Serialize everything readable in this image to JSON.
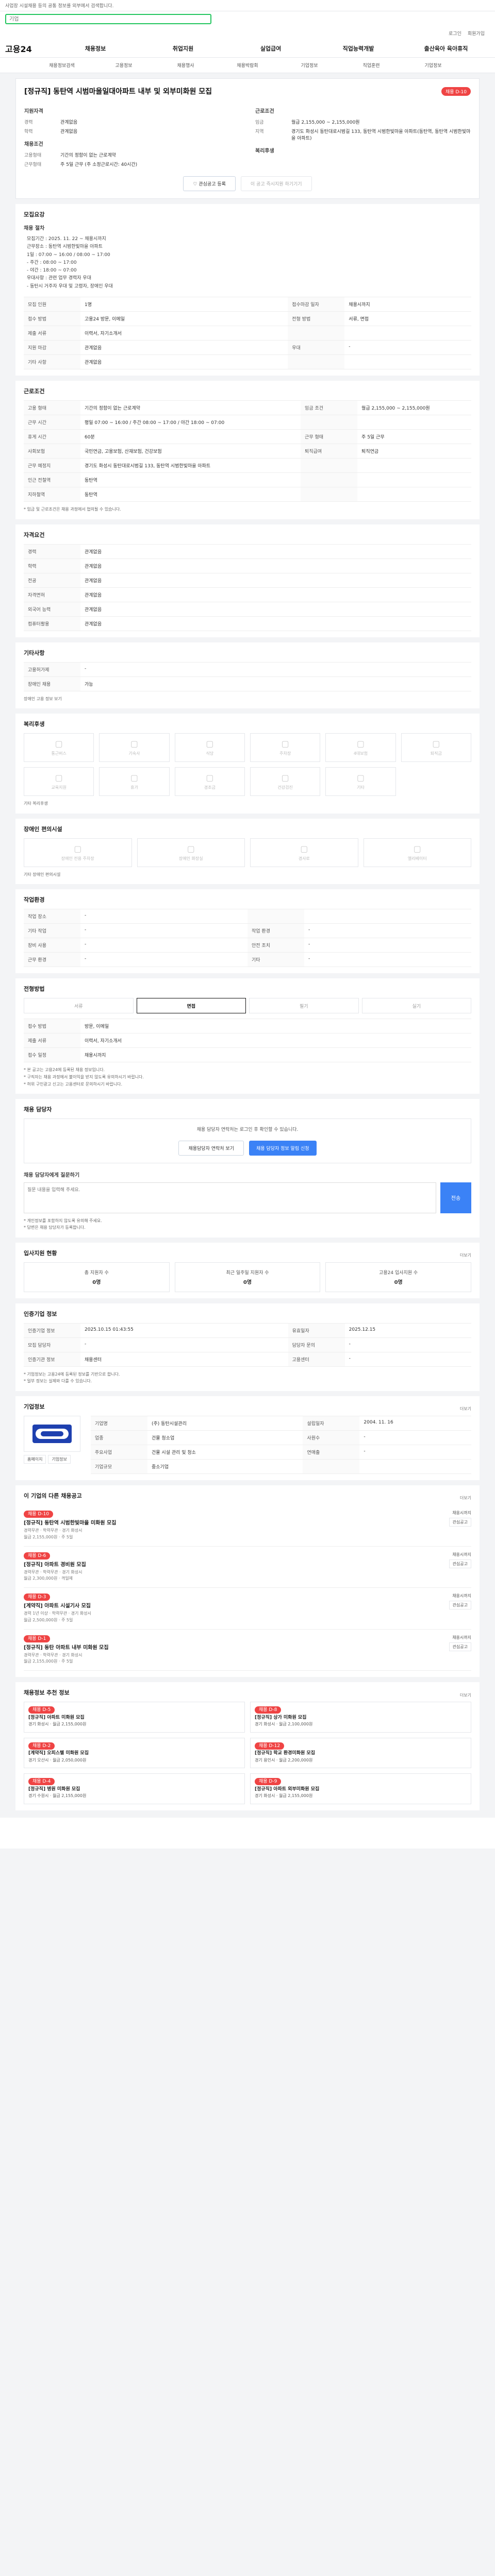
{
  "top": {
    "notice": "사업장 시설채용 등의 공통 정보를 외부에서 검색합니다."
  },
  "search": {
    "placeholder": "기업"
  },
  "login": {
    "login": "로그인",
    "join": "회원가입"
  },
  "logo": "고용24",
  "gnb": [
    "채용정보",
    "취업지원",
    "실업급여",
    "직업능력개발",
    "출산육아 육아휴직"
  ],
  "subnav": [
    "채용정보검색",
    "고용정보",
    "채용행사",
    "채용박람회",
    "기업정보",
    "직업훈련",
    "기업정보"
  ],
  "job": {
    "title": "[정규직] 동탄역 시범마을일대아파트 내부 및 외부미화원 모집",
    "badge": "채용 D-10",
    "summary_h": "지원자격",
    "fields_left": [
      {
        "k": "경력",
        "v": "관계없음"
      },
      {
        "k": "학력",
        "v": "관계없음"
      }
    ],
    "work_h": "근로조건",
    "fields_right": [
      {
        "k": "임금",
        "v": "월급 2,155,000 ~ 2,155,000원"
      },
      {
        "k": "지역",
        "v": "경기도 화성시 동탄대로시범길 133, 동탄역 시범한빛마을 아파트(동탄역, 동탄역 시범한빛마을 아파트)"
      }
    ],
    "extra_h": "채용조건",
    "extra": [
      {
        "k": "고용형태",
        "v": "기간의 정함이 없는 근로계약"
      },
      {
        "k": "근무형태",
        "v": "주 5일 근무 (주 소정근로시간: 40시간)"
      }
    ],
    "perks_h": "복리후생",
    "btn_save": "관심공고 등록",
    "btn_apply": "이 공고 즉시지원 하기기기"
  },
  "process": {
    "h": "모집요강",
    "sub": "채용 절차",
    "items": [
      "모집기간 : 2025. 11. 22 ~ 채용시까지",
      "근무장소 : 동탄역 시범한빛마을 아파트",
      "1일 : 07:00 ~ 16:00 / 08:00 ~ 17:00",
      "- 주간 : 08:00 ~ 17:00",
      "- 야간 : 18:00 ~ 07:00",
      "우대사항 : 관련 업무 경력자 우대",
      "- 동탄시 거주자 우대 및 고령자, 장애인 우대"
    ]
  },
  "reception": {
    "rows": [
      {
        "k": "모집 인원",
        "v": "1명",
        "k2": "접수마감 일자",
        "v2": "채용시까지"
      },
      {
        "k": "접수 방법",
        "v": "고용24 방문, 이메일",
        "k2": "전형 방법",
        "v2": "서류, 면접"
      },
      {
        "k": "제출 서류",
        "v": "이력서, 자기소개서",
        "k2": "",
        "v2": ""
      },
      {
        "k": "지원 마감",
        "v": "관계없음",
        "k2": "우대",
        "v2": "-"
      },
      {
        "k": "기타 사항",
        "v": "관계없음",
        "k2": "",
        "v2": ""
      }
    ]
  },
  "conditions": {
    "h": "근로조건",
    "rows": [
      {
        "k": "고용 형태",
        "v": "기간의 정함이 없는 근로계약",
        "k2": "임금 조건",
        "v2": "월급 2,155,000 ~ 2,155,000원"
      },
      {
        "k": "근무 시간",
        "v": "평일 07:00 ~ 16:00 / 주간 08:00 ~ 17:00 / 야간 18:00 ~ 07:00",
        "k2": "",
        "v2": ""
      },
      {
        "k": "휴게 시간",
        "v": "60분",
        "k2": "근무 형태",
        "v2": "주 5일 근무"
      },
      {
        "k": "사회보험",
        "v": "국민연금, 고용보험, 산재보험, 건강보험",
        "k2": "퇴직급여",
        "v2": "퇴직연금"
      },
      {
        "k": "근무 예정지",
        "v": "경기도 화성시 동탄대로시범길 133, 동탄역 시범한빛마을 아파트",
        "k2": "",
        "v2": ""
      },
      {
        "k": "인근 전철역",
        "v": "동탄역",
        "k2": "",
        "v2": ""
      },
      {
        "k": "지하철역",
        "v": "동탄역",
        "k2": "",
        "v2": ""
      }
    ],
    "note": "* 임금 및 근로조건은 채용 과정에서 협의될 수 있습니다."
  },
  "qualification": {
    "h": "자격요건",
    "rows": [
      {
        "k": "경력",
        "v": "관계없음"
      },
      {
        "k": "학력",
        "v": "관계없음"
      },
      {
        "k": "전공",
        "v": "관계없음"
      },
      {
        "k": "자격면허",
        "v": "관계없음"
      },
      {
        "k": "외국어 능력",
        "v": "관계없음"
      },
      {
        "k": "컴퓨터활용",
        "v": "관계없음"
      }
    ]
  },
  "others": {
    "h": "기타사항",
    "rows": [
      {
        "k": "고용허가제",
        "v": "-"
      },
      {
        "k": "장애인 채용",
        "v": "가능"
      }
    ],
    "link": "장애인 고용 정보 보기"
  },
  "welfare": {
    "h": "복리후생",
    "items": [
      "통근버스",
      "기숙사",
      "식당",
      "주차장",
      "4대보험",
      "퇴직금",
      "교육지원",
      "휴가",
      "경조금",
      "건강검진",
      "기타"
    ],
    "more": "기타 복리후생"
  },
  "disabled": {
    "h": "장애인 편의시설",
    "items": [
      "장애인 전용 주차장",
      "장애인 화장실",
      "경사로",
      "엘리베이터"
    ],
    "more": "기타 장애인 편의시설"
  },
  "environment": {
    "h": "작업환경",
    "rows": [
      {
        "k": "작업 장소",
        "v": "-",
        "k2": "",
        "v2": ""
      },
      {
        "k": "기타 작업",
        "v": "-",
        "k2": "작업 환경",
        "v2": "-"
      },
      {
        "k": "장비 사용",
        "v": "-",
        "k2": "안전 조치",
        "v2": "-"
      },
      {
        "k": "근무 환경",
        "v": "-",
        "k2": "기타",
        "v2": "-"
      }
    ]
  },
  "screening": {
    "h": "전형방법",
    "tabs": [
      "서류",
      "면접",
      "필기",
      "실기"
    ],
    "rows": [
      {
        "k": "접수 방법",
        "v": "방문, 이메일"
      },
      {
        "k": "제출 서류",
        "v": "이력서, 자기소개서"
      },
      {
        "k": "접수 일정",
        "v": "채용시까지"
      }
    ],
    "notes": [
      "* 본 공고는 고용24에 등록된 채용 정보입니다.",
      "* 구직자는 채용 과정에서 불이익을 받지 않도록 유의하시기 바랍니다.",
      "* 허위 구인광고 신고는 고용센터로 문의하시기 바랍니다."
    ]
  },
  "contact": {
    "h": "채용 담당자",
    "text": "채용 담당자 연락처는 로그인 후 확인할 수 있습니다.",
    "btn1": "채용담당자 연락처 보기",
    "btn2": "채용 담당자 정보 알림 신청"
  },
  "qna": {
    "h": "채용 담당자에게 질문하기",
    "placeholder": "질문 내용을 입력해 주세요.",
    "send": "전송",
    "notes": [
      "* 개인정보를 포함하지 않도록 유의해 주세요.",
      "* 답변은 채용 담당자가 등록합니다."
    ]
  },
  "stats": {
    "h": "입사지원 현황",
    "more": "더보기",
    "items": [
      {
        "label": "총 지원자 수",
        "value": "0명"
      },
      {
        "label": "최근 일주일 지원자 수",
        "value": "0명"
      },
      {
        "label": "고용24 입사지원 수",
        "value": "0명"
      }
    ]
  },
  "office": {
    "h": "인증기업 정보",
    "rows": [
      {
        "k": "인증기업 정보",
        "v": "2025.10.15 01:43:55",
        "k2": "유효일자",
        "v2": "2025.12.15"
      },
      {
        "k": "모집 담당자",
        "v": "-",
        "k2": "담당자 문의",
        "v2": "-"
      },
      {
        "k": "인증기관 정보",
        "v": "채용센터",
        "k2": "고용센터",
        "v2": "-"
      }
    ],
    "notes": [
      "* 기업정보는 고용24에 등록된 정보를 기반으로 합니다.",
      "* 일부 정보는 실제와 다를 수 있습니다."
    ]
  },
  "company": {
    "h": "기업정보",
    "more": "더보기",
    "rows": [
      {
        "k": "기업명",
        "v": "(주) 동탄시설관리",
        "k2": "설립일자",
        "v2": "2004. 11. 16"
      },
      {
        "k": "업종",
        "v": "건물 청소업",
        "k2": "사원수",
        "v2": "-"
      },
      {
        "k": "주요사업",
        "v": "건물 시설 관리 및 청소",
        "k2": "연매출",
        "v2": "-"
      },
      {
        "k": "기업규모",
        "v": "중소기업",
        "k2": "",
        "v2": ""
      }
    ],
    "chips": [
      "홈페이지",
      "기업정보"
    ]
  },
  "others_jobs": {
    "h": "이 기업의 다른 채용공고",
    "more": "더보기",
    "items": [
      {
        "tag": "채용 D-10",
        "title": "[정규직] 동탄역 시범한빛마을 미화원 모집",
        "meta1": "경력무관 · 학력무관 · 경기 화성시",
        "meta2": "월급 2,155,000원 · 주 5일",
        "side1": "채용시까지",
        "side2": "관심공고"
      },
      {
        "tag": "채용 D-6",
        "title": "[정규직] 아파트 경비원 모집",
        "meta1": "경력무관 · 학력무관 · 경기 화성시",
        "meta2": "월급 2,300,000원 · 격일제",
        "side1": "채용시까지",
        "side2": "관심공고"
      },
      {
        "tag": "채용 D-3",
        "title": "[계약직] 아파트 시설기사 모집",
        "meta1": "경력 1년 이상 · 학력무관 · 경기 화성시",
        "meta2": "월급 2,500,000원 · 주 5일",
        "side1": "채용시까지",
        "side2": "관심공고"
      },
      {
        "tag": "채용 D-1",
        "title": "[정규직] 동탄 아파트 내부 미화원 모집",
        "meta1": "경력무관 · 학력무관 · 경기 화성시",
        "meta2": "월급 2,155,000원 · 주 5일",
        "side1": "채용시까지",
        "side2": "관심공고"
      }
    ]
  },
  "similar": {
    "h": "채용정보 추천 정보",
    "more": "더보기",
    "items": [
      {
        "tag": "채용 D-5",
        "title": "[정규직] 아파트 미화원 모집",
        "meta": "경기 화성시 · 월급 2,155,000원"
      },
      {
        "tag": "채용 D-8",
        "title": "[정규직] 상가 미화원 모집",
        "meta": "경기 화성시 · 월급 2,100,000원"
      },
      {
        "tag": "채용 D-2",
        "title": "[계약직] 오피스텔 미화원 모집",
        "meta": "경기 오산시 · 월급 2,050,000원"
      },
      {
        "tag": "채용 D-12",
        "title": "[정규직] 학교 환경미화원 모집",
        "meta": "경기 용인시 · 월급 2,200,000원"
      },
      {
        "tag": "채용 D-4",
        "title": "[정규직] 병원 미화원 모집",
        "meta": "경기 수원시 · 월급 2,155,000원"
      },
      {
        "tag": "채용 D-9",
        "title": "[정규직] 아파트 외부미화원 모집",
        "meta": "경기 화성시 · 월급 2,155,000원"
      }
    ]
  }
}
